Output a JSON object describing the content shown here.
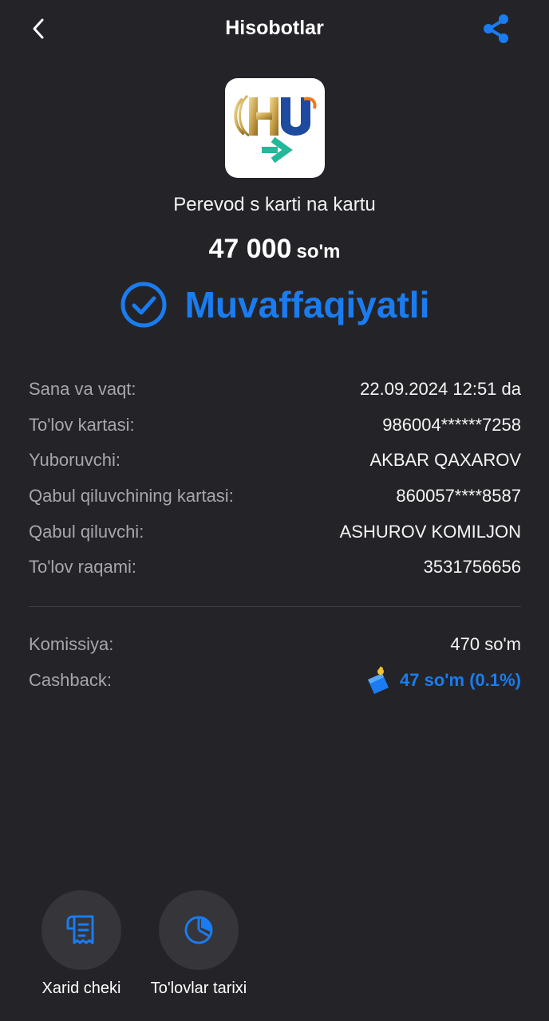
{
  "header": {
    "title": "Hisobotlar",
    "accent_color": "#1a7cf0"
  },
  "transaction": {
    "title": "Perevod s karti na kartu",
    "amount": "47 000",
    "currency": "so'm",
    "status": "Muvaffaqiyatli"
  },
  "details": [
    {
      "label": "Sana va vaqt:",
      "value": "22.09.2024 12:51 da"
    },
    {
      "label": "To'lov kartasi:",
      "value": "986004******7258"
    },
    {
      "label": "Yuboruvchi:",
      "value": "AKBAR QAXAROV"
    },
    {
      "label": "Qabul qiluvchining kartasi:",
      "value": "860057****8587"
    },
    {
      "label": "Qabul qiluvchi:",
      "value": "ASHUROV KOMILJON"
    },
    {
      "label": "To'lov raqami:",
      "value": "3531756656"
    }
  ],
  "fees": {
    "commission_label": "Komissiya:",
    "commission_value": "470 so'm",
    "cashback_label": "Cashback:",
    "cashback_value": "47 so'm (0.1%)",
    "cashback_icon": "cashback-coin-icon"
  },
  "actions": [
    {
      "label": "Xarid cheki",
      "icon": "receipt-icon"
    },
    {
      "label": "To'lovlar tarixi",
      "icon": "pie-chart-icon"
    }
  ]
}
